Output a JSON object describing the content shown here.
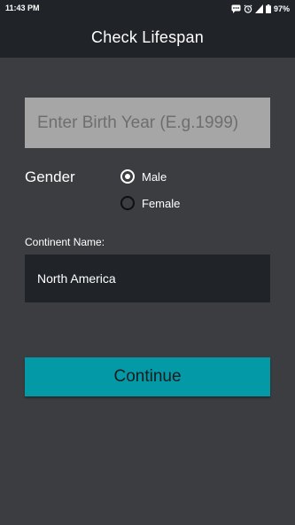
{
  "status_bar": {
    "time": "11:43 PM",
    "battery_text": "97%",
    "icons": [
      "message-icon",
      "alarm-icon",
      "signal-icon",
      "battery-icon"
    ]
  },
  "app_bar": {
    "title": "Check Lifespan"
  },
  "form": {
    "birth_year": {
      "value": "",
      "placeholder": "Enter Birth Year (E.g.1999)"
    },
    "gender": {
      "label": "Gender",
      "options": [
        {
          "label": "Male",
          "selected": true
        },
        {
          "label": "Female",
          "selected": false
        }
      ]
    },
    "continent": {
      "label": "Continent Name:",
      "selected_value": "North America"
    },
    "continue_label": "Continue"
  },
  "colors": {
    "background": "#3b3d40",
    "bar": "#202328",
    "input_bg": "#a6a6a6",
    "accent": "#0499a6"
  }
}
